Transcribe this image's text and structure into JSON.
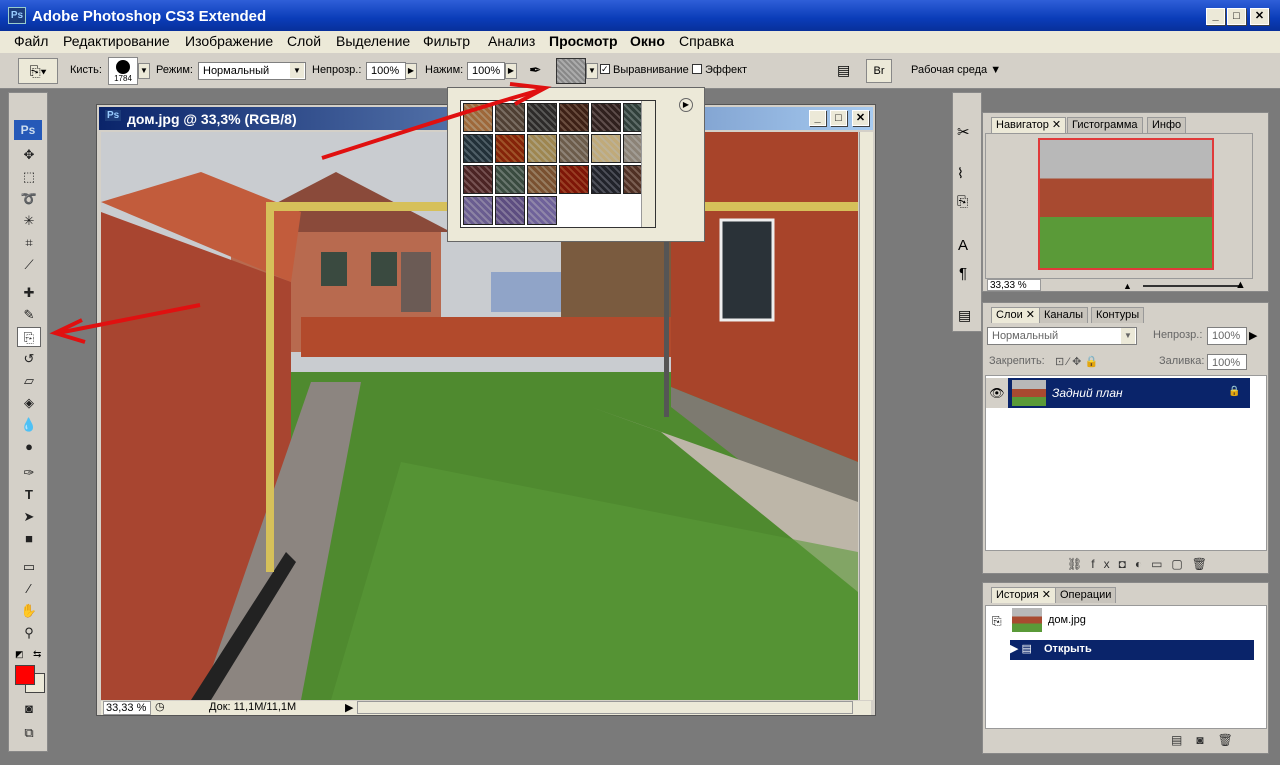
{
  "app": {
    "title": "Adobe Photoshop CS3 Extended",
    "icon": "ps-logo-icon"
  },
  "window_controls": {
    "minimize": "_",
    "maximize": "□",
    "close": "✕"
  },
  "menu": [
    "Файл",
    "Редактирование",
    "Изображение",
    "Слой",
    "Выделение",
    "Фильтр",
    "Анализ",
    "Просмотр",
    "Окно",
    "Справка"
  ],
  "options": {
    "brush_label": "Кисть:",
    "brush_size": "1784",
    "mode_label": "Режим:",
    "mode_value": "Нормальный",
    "opacity_label": "Непрозр.:",
    "opacity_value": "100%",
    "flow_label": "Нажим:",
    "flow_value": "100%",
    "align_label": "Выравнивание",
    "align_checked": true,
    "impression_label": "Эффект",
    "impression_checked": false,
    "workspace": "Рабочая среда"
  },
  "document": {
    "title": "дом.jpg @ 33,3% (RGB/8)",
    "zoom": "33,33 %",
    "doc_size": "Док: 11,1M/11,1M"
  },
  "navigator_panel": {
    "tabs": [
      "Навигатор",
      "Гистограмма",
      "Инфо"
    ],
    "zoom": "33,33 %"
  },
  "layers_panel": {
    "tabs": [
      "Слои",
      "Каналы",
      "Контуры"
    ],
    "blend_mode": "Нормальный",
    "opacity_label": "Непрозр.:",
    "opacity_value": "100%",
    "lock_label": "Закрепить:",
    "fill_label": "Заливка:",
    "fill_value": "100%",
    "layers": [
      {
        "name": "Задний план",
        "locked": true,
        "visible": true
      }
    ]
  },
  "history_panel": {
    "tabs": [
      "История",
      "Операции"
    ],
    "snapshot": "дом.jpg",
    "steps": [
      "Открыть"
    ]
  },
  "colors": {
    "foreground": "#ff0000",
    "background": "#ece9d8",
    "accent": "#0a246a",
    "annotation": "#e01010"
  },
  "patterns": [
    "#c9a37a",
    "#8e7f72",
    "#6a6866",
    "#7d5a4a",
    "#6e5a58",
    "#6f7f7a",
    "#5d6f78",
    "#b8602f",
    "#c9b98f",
    "#a6998a",
    "#ddd0b0",
    "#bdb7ae",
    "#8a6060",
    "#7a8a80",
    "#b09070",
    "#b34a2a",
    "#5c5e68",
    "#8f6f60",
    "#a49ac0",
    "#9a8cb5",
    "#a89ec6"
  ]
}
